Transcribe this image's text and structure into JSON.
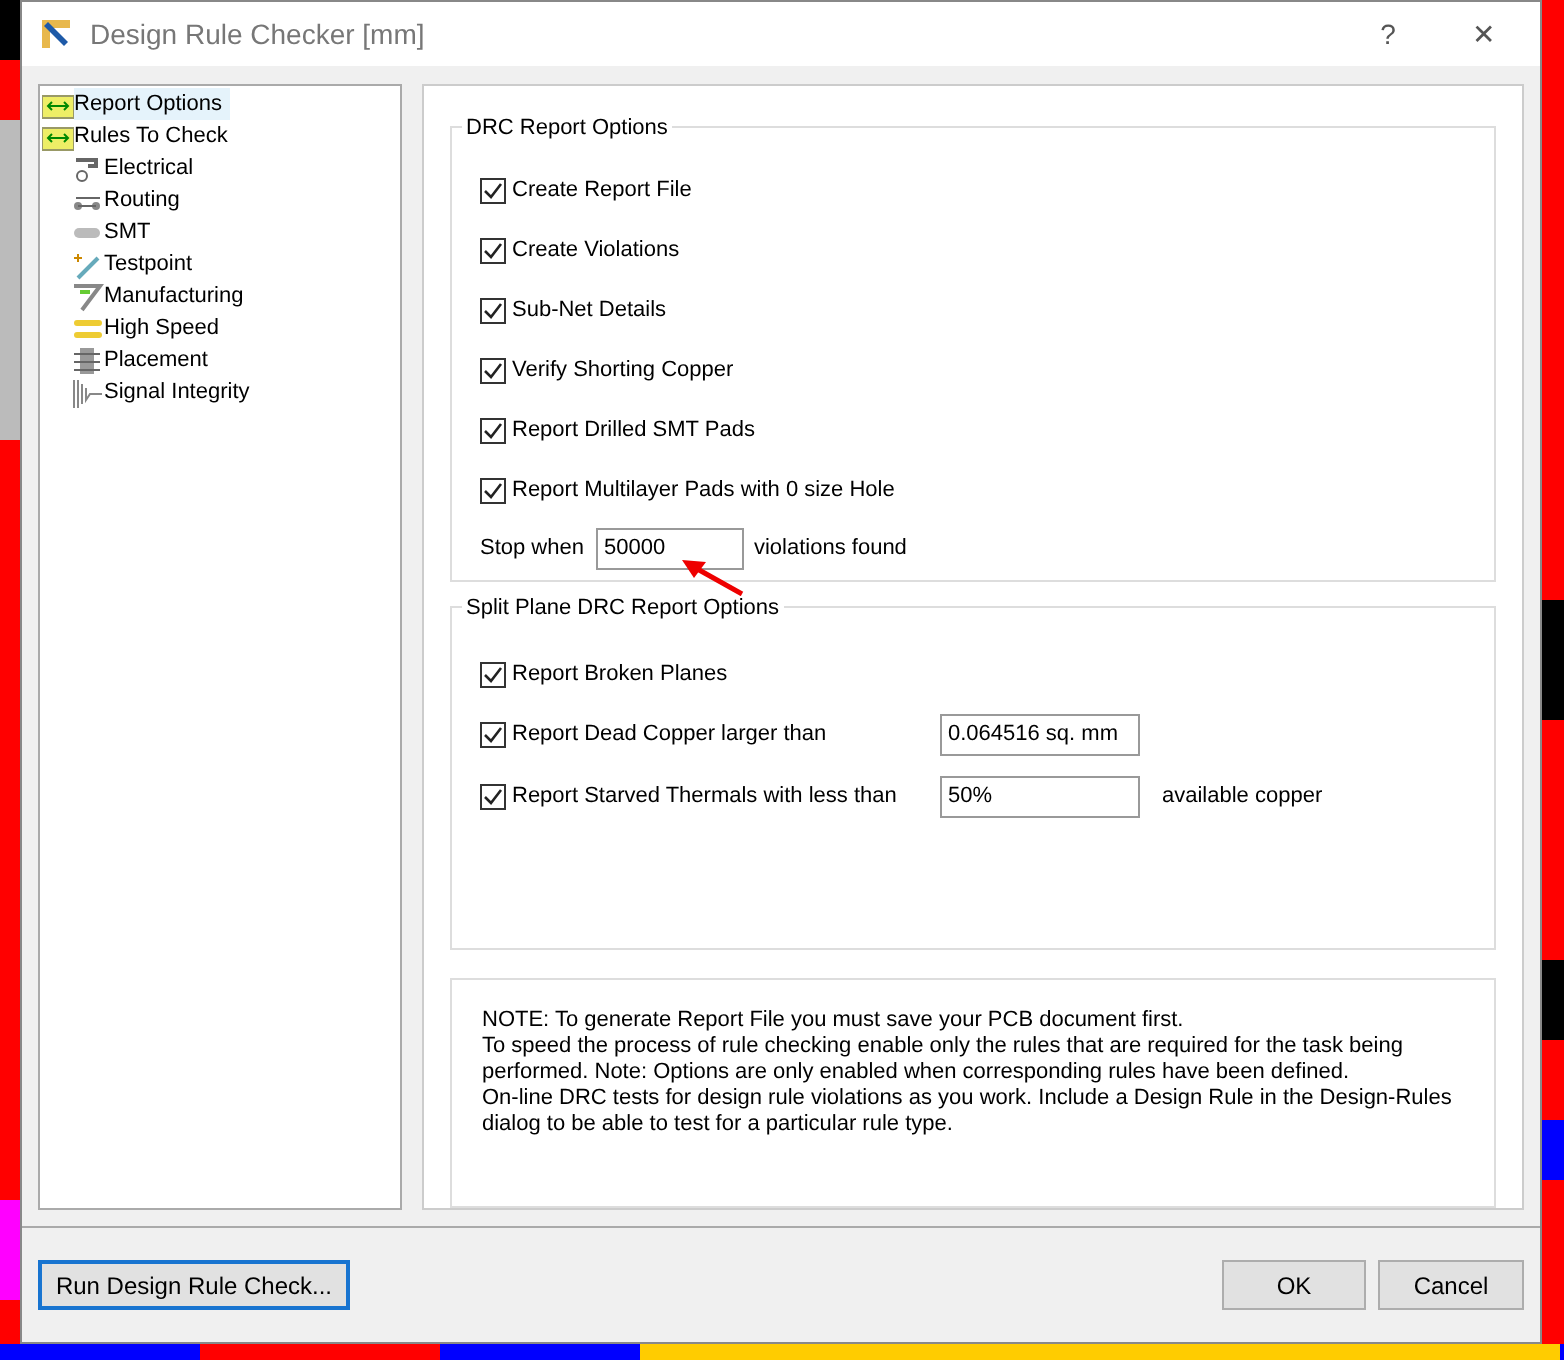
{
  "window": {
    "title": "Design Rule Checker [mm]",
    "help_button": "?",
    "close_button": "✕"
  },
  "tree": [
    {
      "label": "Report Options",
      "selected": true
    },
    {
      "label": "Rules To Check",
      "selected": false,
      "children": [
        {
          "label": "Electrical",
          "selected": false
        },
        {
          "label": "Routing",
          "selected": false
        },
        {
          "label": "SMT",
          "selected": false
        },
        {
          "label": "Testpoint",
          "selected": false
        },
        {
          "label": "Manufacturing",
          "selected": false
        },
        {
          "label": "High Speed",
          "selected": false
        },
        {
          "label": "Placement",
          "selected": false
        },
        {
          "label": "Signal Integrity",
          "selected": false
        }
      ]
    }
  ],
  "drc_report_options": {
    "title": "DRC Report Options",
    "options": [
      {
        "label": "Create Report File",
        "checked": true
      },
      {
        "label": "Create Violations",
        "checked": true
      },
      {
        "label": "Sub-Net Details",
        "checked": true
      },
      {
        "label": "Verify Shorting Copper",
        "checked": true
      },
      {
        "label": "Report Drilled SMT Pads",
        "checked": true
      },
      {
        "label": "Report Multilayer Pads with 0 size Hole",
        "checked": true
      }
    ],
    "stop_when": {
      "label": "Stop when",
      "value": "50000",
      "suffix": "violations found"
    }
  },
  "split_plane_options": {
    "title": "Split Plane DRC Report Options",
    "options": [
      {
        "label": "Report Broken Planes",
        "checked": true
      },
      {
        "label": "Report Dead Copper larger than",
        "checked": true,
        "value": "0.064516 sq. mm"
      },
      {
        "label": "Report Starved Thermals with less than",
        "checked": true,
        "value": "50%",
        "suffix": "available copper"
      }
    ]
  },
  "note": [
    "NOTE: To generate Report File you must save your PCB document first.",
    "To speed the process of rule checking enable only the rules that are required for the task being performed.  Note: Options are only enabled when corresponding rules have been defined.",
    "On-line DRC tests for design rule violations as you work. Include a Design Rule in the Design-Rules dialog to be able to test for a particular rule  type."
  ],
  "buttons": {
    "run": "Run Design Rule Check...",
    "ok": "OK",
    "cancel": "Cancel"
  }
}
